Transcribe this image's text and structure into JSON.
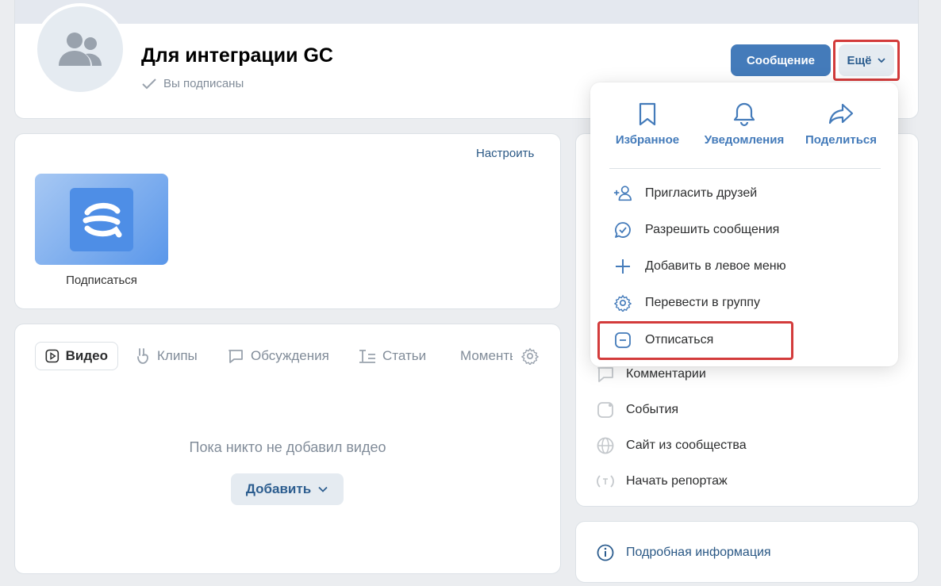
{
  "group": {
    "title": "Для интеграции GC",
    "subscribed_label": "Вы подписаны"
  },
  "header": {
    "message_button": "Сообщение",
    "more_button": "Ещё"
  },
  "apps": {
    "configure": "Настроить",
    "app_label": "Подписаться"
  },
  "media": {
    "tabs": [
      "Видео",
      "Клипы",
      "Обсуждения",
      "Статьи",
      "Моменты"
    ],
    "empty_text": "Пока никто не добавил видео",
    "add_button": "Добавить"
  },
  "dropdown": {
    "quick_actions": [
      "Избранное",
      "Уведомления",
      "Поделиться"
    ],
    "items": [
      {
        "label": "Пригласить друзей",
        "icon": "add-user-icon"
      },
      {
        "label": "Разрешить сообщения",
        "icon": "message-check-icon"
      },
      {
        "label": "Добавить в левое меню",
        "icon": "plus-icon"
      },
      {
        "label": "Перевести в группу",
        "icon": "gear-icon"
      },
      {
        "label": "Отписаться",
        "icon": "minus-square-icon"
      }
    ]
  },
  "sidebar": {
    "items": [
      {
        "label": "Комментарии",
        "icon": "comment-icon"
      },
      {
        "label": "События",
        "icon": "event-icon"
      },
      {
        "label": "Сайт из сообщества",
        "icon": "globe-icon"
      },
      {
        "label": "Начать репортаж",
        "icon": "broadcast-icon"
      }
    ],
    "info_link": "Подробная информация"
  },
  "colors": {
    "accent": "#447bba",
    "highlight": "#d33b3b",
    "muted": "#818c99"
  }
}
